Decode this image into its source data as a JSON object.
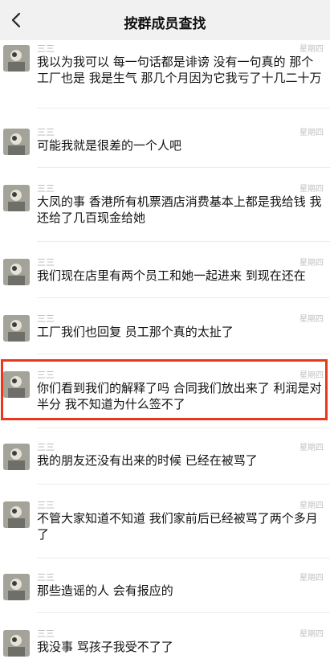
{
  "nav": {
    "title": "按群成员查找",
    "back_icon": "chevron-left-icon"
  },
  "messages": [
    {
      "sender": "三三",
      "time": "星期四",
      "text": "我以为我可以 每一句话都是诽谤 没有一句真的 那个工厂也是 我是生气 那几个月因为它我亏了十几二十万"
    },
    {
      "sender": "三三",
      "time": "星期四",
      "text": "可能我就是很差的一个人吧"
    },
    {
      "sender": "三三",
      "time": "星期四",
      "text": "大凤的事 香港所有机票酒店消费基本上都是我给钱 我还给了几百现金给她"
    },
    {
      "sender": "三三",
      "time": "星期四",
      "text": "我们现在店里有两个员工和她一起进来 到现在还在"
    },
    {
      "sender": "三三",
      "time": "星期四",
      "text": "工厂我们也回复 员工那个真的太扯了"
    },
    {
      "sender": "三三",
      "time": "星期四",
      "text": "你们看到我们的解释了吗 合同我们放出来了 利润是对半分 我不知道为什么签不了",
      "highlighted": true
    },
    {
      "sender": "三三",
      "time": "星期四",
      "text": "我的朋友还没有出来的时候 已经在被骂了"
    },
    {
      "sender": "三三",
      "time": "星期四",
      "text": "不管大家知道不知道 我们家前后已经被骂了两个多月了"
    },
    {
      "sender": "三三",
      "time": "星期四",
      "text": "那些造谣的人 会有报应的"
    },
    {
      "sender": "三三",
      "time": "星期四",
      "text": "我没事 骂孩子我受不了了"
    }
  ]
}
